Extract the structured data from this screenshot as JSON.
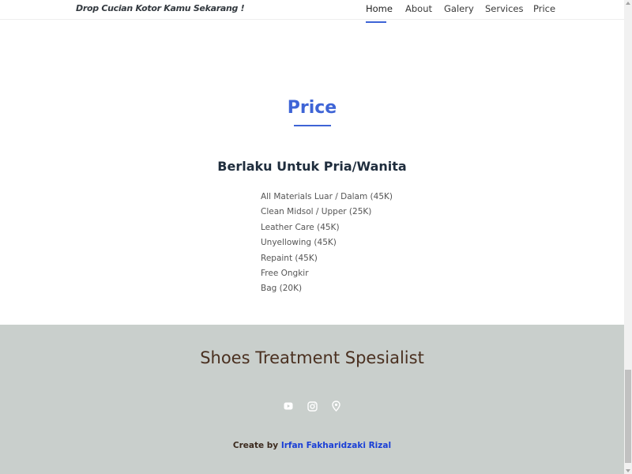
{
  "navbar": {
    "brand": "Drop Cucian Kotor Kamu Sekarang !",
    "items": [
      {
        "label": "Home",
        "active": true
      },
      {
        "label": "About"
      },
      {
        "label": "Galery"
      },
      {
        "label": "Services"
      },
      {
        "label": "Price"
      }
    ]
  },
  "price_section": {
    "title": "Price",
    "subtitle": "Berlaku Untuk Pria/Wanita",
    "items": [
      "All Materials Luar / Dalam (45K)",
      "Clean Midsol / Upper (25K)",
      "Leather Care (45K)",
      "Unyellowing (45K)",
      "Repaint (45K)",
      "Free Ongkir",
      "Bag (20K)"
    ]
  },
  "footer": {
    "title": "Shoes Treatment Spesialist",
    "social_icons": [
      "youtube-icon",
      "instagram-icon",
      "location-icon"
    ],
    "credit_prefix": "Create by",
    "credit_author": "Irfan Fakharidzaki Rizal"
  },
  "colors": {
    "accent": "#3e64d6",
    "footer_bg": "#c9cfcc",
    "footer_title": "#4a3020",
    "author_link": "#1a3fd6"
  }
}
